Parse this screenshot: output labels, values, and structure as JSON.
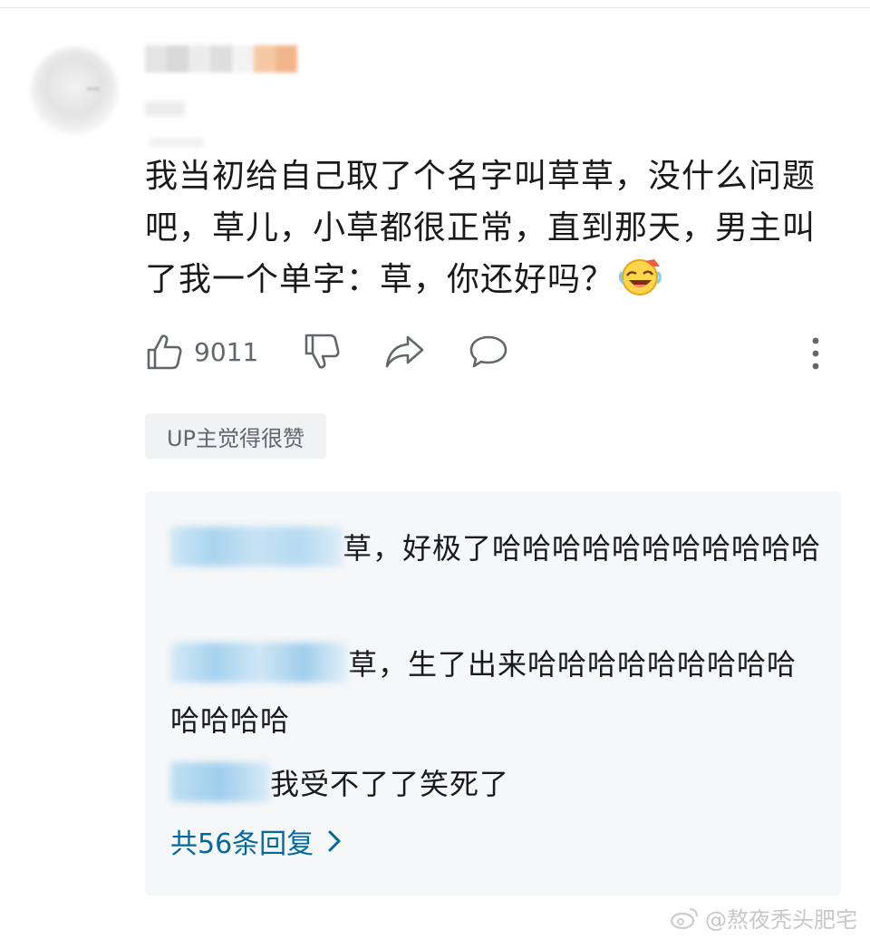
{
  "comment": {
    "text": "我当初给自己取了个名字叫草草，没什么问题吧，草儿，小草都很正常，直到那天，男主叫了我一个单字：草，你还好吗？",
    "emoji": "laugh-cry-emoji"
  },
  "actions": {
    "like_count": "9011",
    "icons": [
      "thumbs-up-icon",
      "thumbs-down-icon",
      "share-icon",
      "reply-icon",
      "more-icon"
    ]
  },
  "badge": "UP主觉得很赞",
  "replies": [
    {
      "text": "草，好极了哈哈哈哈哈哈哈哈哈哈哈"
    },
    {
      "text": "草，生了出来哈哈哈哈哈哈哈哈哈哈哈哈哈"
    },
    {
      "text": "我受不了了笑死了"
    }
  ],
  "more_replies": "共56条回复",
  "watermark": "@熬夜秃头肥宅",
  "colors": {
    "link": "#00699d",
    "secondary_text": "#61666d",
    "reply_bg": "#f6f7f8"
  }
}
